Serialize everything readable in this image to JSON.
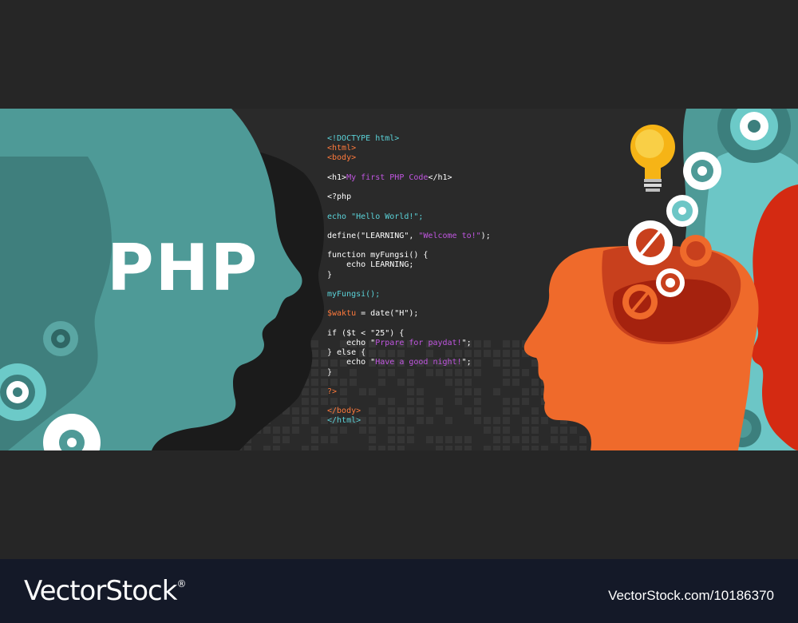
{
  "banner": {
    "title": "PHP",
    "colors": {
      "background": "#262626",
      "teal": "#4e9a97",
      "teal_dark": "#3f7f7d",
      "orange": "#ef6a2b",
      "red": "#d42a12",
      "dark_red": "#a5220e",
      "bulb": "#f6b416"
    },
    "icons": [
      "gear-icon",
      "lightbulb-icon",
      "head-silhouette-icon"
    ],
    "code_lines": [
      {
        "text": "<!DOCTYPE html>",
        "color": "cyan"
      },
      {
        "text": "<html>",
        "color": "orange"
      },
      {
        "text": "<body>",
        "color": "orange"
      },
      {
        "text": "",
        "color": "white"
      },
      {
        "segments": [
          {
            "t": "<h1>",
            "c": "white"
          },
          {
            "t": "My first PHP Code",
            "c": "purple"
          },
          {
            "t": "</h1>",
            "c": "white"
          }
        ]
      },
      {
        "text": "",
        "color": "white"
      },
      {
        "text": "<?php",
        "color": "white"
      },
      {
        "text": "",
        "color": "white"
      },
      {
        "text": "echo \"Hello World!\";",
        "color": "cyan"
      },
      {
        "text": "",
        "color": "white"
      },
      {
        "segments": [
          {
            "t": "define(\"LEARNING\", ",
            "c": "white"
          },
          {
            "t": "\"Welcome to!\"",
            "c": "purple"
          },
          {
            "t": ");",
            "c": "white"
          }
        ]
      },
      {
        "text": "",
        "color": "white"
      },
      {
        "text": "function myFungsi() {",
        "color": "white"
      },
      {
        "text": "    echo LEARNING;",
        "color": "white"
      },
      {
        "text": "}",
        "color": "white"
      },
      {
        "text": "",
        "color": "white"
      },
      {
        "text": "myFungsi();",
        "color": "cyan"
      },
      {
        "text": "",
        "color": "white"
      },
      {
        "segments": [
          {
            "t": "$waktu",
            "c": "orange"
          },
          {
            "t": " = date(\"H\");",
            "c": "white"
          }
        ]
      },
      {
        "text": "",
        "color": "white"
      },
      {
        "text": "if ($t < \"25\") {",
        "color": "white"
      },
      {
        "segments": [
          {
            "t": "    echo \"",
            "c": "white"
          },
          {
            "t": "Prpare for paydat!",
            "c": "purple"
          },
          {
            "t": "\";",
            "c": "white"
          }
        ]
      },
      {
        "text": "} else {",
        "color": "white"
      },
      {
        "segments": [
          {
            "t": "    echo \"",
            "c": "white"
          },
          {
            "t": "Have a good night!",
            "c": "purple"
          },
          {
            "t": "\";",
            "c": "white"
          }
        ]
      },
      {
        "text": "}",
        "color": "white"
      },
      {
        "text": "",
        "color": "white"
      },
      {
        "text": "?>",
        "color": "orange"
      },
      {
        "text": "",
        "color": "white"
      },
      {
        "text": "</body>",
        "color": "orange"
      },
      {
        "text": "</html>",
        "color": "cyan"
      }
    ]
  },
  "footer": {
    "brand": "VectorStock",
    "registered": "®",
    "image_id": "VectorStock.com/10186370"
  }
}
